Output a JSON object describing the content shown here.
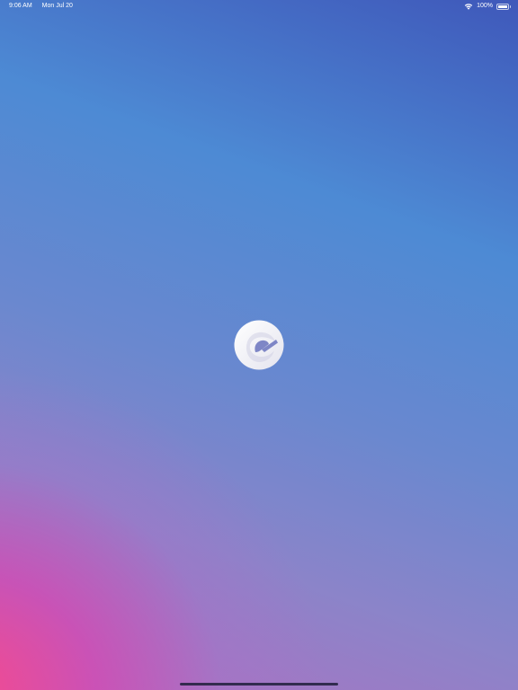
{
  "status_bar": {
    "time": "9:06 AM",
    "date": "Mon Jul 20",
    "battery_text": "100%",
    "battery_level": 1.0,
    "wifi_icon": "wifi-icon",
    "battery_icon": "battery-icon"
  },
  "splash": {
    "logo_icon": "app-logo-icon"
  },
  "colors": {
    "gradient_blue": "#4d8ad4",
    "gradient_pink": "#f8488c",
    "logo": "#ffffff"
  }
}
